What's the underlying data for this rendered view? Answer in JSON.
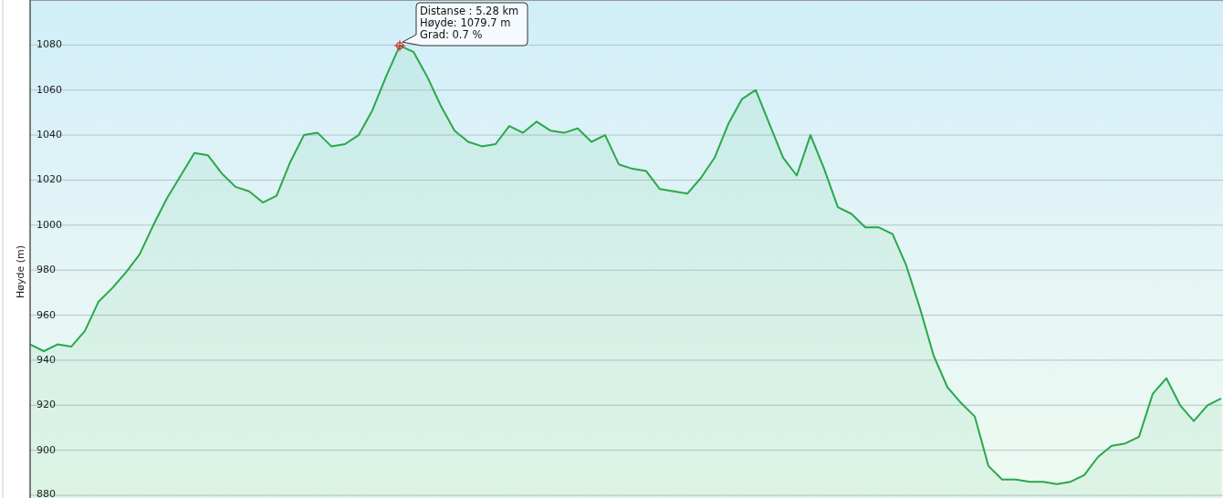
{
  "chart_data": {
    "type": "area",
    "ylabel": "Høyde (m)",
    "ylim": [
      880,
      1100
    ],
    "yticks": [
      880,
      900,
      920,
      940,
      960,
      980,
      1000,
      1020,
      1040,
      1060,
      1080
    ],
    "grid": true,
    "categories": [
      null,
      null,
      null,
      null,
      null,
      null,
      null,
      null,
      null,
      null,
      null,
      null,
      null,
      null,
      null,
      null,
      null,
      null,
      null,
      null,
      null,
      null,
      null,
      null,
      null,
      null,
      null,
      null,
      null,
      null,
      null,
      null,
      null,
      null,
      null,
      null,
      null,
      null,
      null,
      null,
      null,
      null,
      null,
      null,
      null,
      null,
      null,
      null,
      null,
      null,
      null,
      null,
      null,
      null,
      null,
      null,
      null,
      null,
      null,
      null,
      null,
      null,
      null,
      null,
      null,
      null,
      null,
      null,
      null,
      null,
      null,
      null,
      null,
      null,
      null,
      null,
      null,
      null,
      null,
      null,
      null,
      null,
      null,
      null,
      null,
      null,
      null,
      null
    ],
    "series": [
      {
        "color": "#2aa84a",
        "values": [
          947,
          944,
          947,
          946,
          953,
          966,
          972,
          979,
          987,
          1000,
          1012,
          1022,
          1032,
          1031,
          1023,
          1017,
          1015,
          1010,
          1013,
          1028,
          1040,
          1041,
          1035,
          1036,
          1040,
          1051,
          1066,
          1079.7,
          1077,
          1066,
          1053,
          1042,
          1037,
          1035,
          1036,
          1044,
          1041,
          1046,
          1042,
          1041,
          1043,
          1037,
          1040,
          1027,
          1025,
          1024,
          1016,
          1015,
          1014,
          1021,
          1030,
          1045,
          1056,
          1060,
          1045,
          1030,
          1022,
          1040,
          1025,
          1008,
          1005,
          999,
          999,
          996,
          982,
          963,
          942,
          928,
          921,
          915,
          893,
          887,
          887,
          886,
          886,
          885,
          886,
          889,
          897,
          902,
          903,
          906,
          925,
          932,
          920,
          913,
          920,
          923
        ]
      }
    ]
  },
  "tooltip": {
    "lines": [
      "Distanse : 5.28 km",
      "Høyde: 1079.7 m",
      "Grad: 0.7 %"
    ]
  }
}
